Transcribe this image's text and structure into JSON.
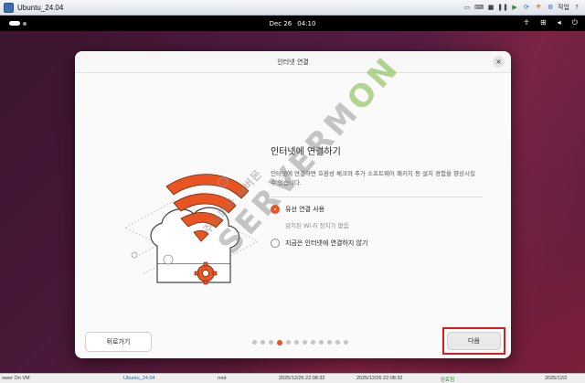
{
  "vm_window": {
    "title": "Ubuntu_24.04",
    "control_label": "작업"
  },
  "topbar": {
    "date": "Dec 26",
    "time": "04:10"
  },
  "dialog": {
    "title": "인터넷 연결",
    "heading": "인터넷에 연결하기",
    "description": "인터넷에 연결하면 호환성 체크와 추가 소프트웨어 패키지 등 설치 경험을 향상시킬 수 있습니다.",
    "options": [
      {
        "label": "유선 연결 사용",
        "selected": true
      },
      {
        "label": "감지된 Wi-Fi 장치가 없음",
        "note": true
      },
      {
        "label": "지금은 인터넷에 연결하지 않기",
        "selected": false
      }
    ],
    "back_label": "뒤로가기",
    "next_label": "다음",
    "pager": {
      "total": 12,
      "active": 3
    }
  },
  "watermark": {
    "text_main_a": "SERVER",
    "text_main_b": "M",
    "text_main_c": "ON",
    "text_sub": "주식회사 서버몬"
  },
  "statusbar": {
    "left": "ower On VM",
    "vm": "Ubuntu_24.04",
    "user": "root",
    "time1": "2025/12/26 22:08:32",
    "time2": "2025/12/26 22:08:32",
    "status": "완료됨",
    "time3": "2025/12/2"
  },
  "colors": {
    "accent": "#e95420",
    "highlight_border": "#d41f1f"
  }
}
